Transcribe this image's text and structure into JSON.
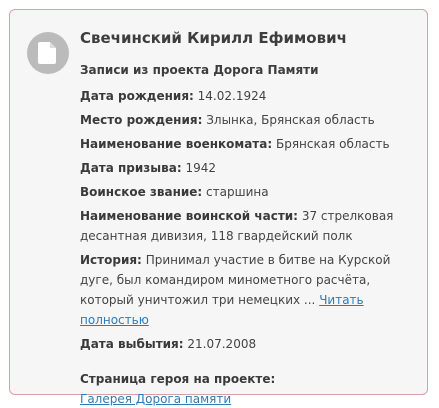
{
  "icon": "document-icon",
  "person": {
    "name": "Свечинский Кирилл Ефимович"
  },
  "project_title": "Записи из проекта Дорога Памяти",
  "fields": {
    "birth_date": {
      "label": "Дата рождения:",
      "value": "14.02.1924"
    },
    "birth_place": {
      "label": "Место рождения:",
      "value": "Злынка, Брянская область"
    },
    "enlistment_office": {
      "label": "Наименование военкомата:",
      "value": "Брянская область"
    },
    "draft_date": {
      "label": "Дата призыва:",
      "value": "1942"
    },
    "rank": {
      "label": "Воинское звание:",
      "value": "старшина"
    },
    "unit": {
      "label": "Наименование воинской части:",
      "value": "37 стрелковая десантная дивизия, 118 гвардейский полк"
    },
    "history": {
      "label": "История:",
      "value": "Принимал участие в битве на Курской дуге, был командиром минометного расчёта, который уничтожил три немецких ...",
      "read_more": "Читать полностью"
    },
    "departure_date": {
      "label": "Дата выбытия:",
      "value": "21.07.2008"
    }
  },
  "hero_page": {
    "label": "Страница героя на проекте:",
    "link": "Галерея Дорога памяти"
  },
  "colors": {
    "border": "#d9a0a8",
    "background": "#f6f6f6",
    "link": "#2f7ab5",
    "icon_bg": "#bbbbbb"
  }
}
